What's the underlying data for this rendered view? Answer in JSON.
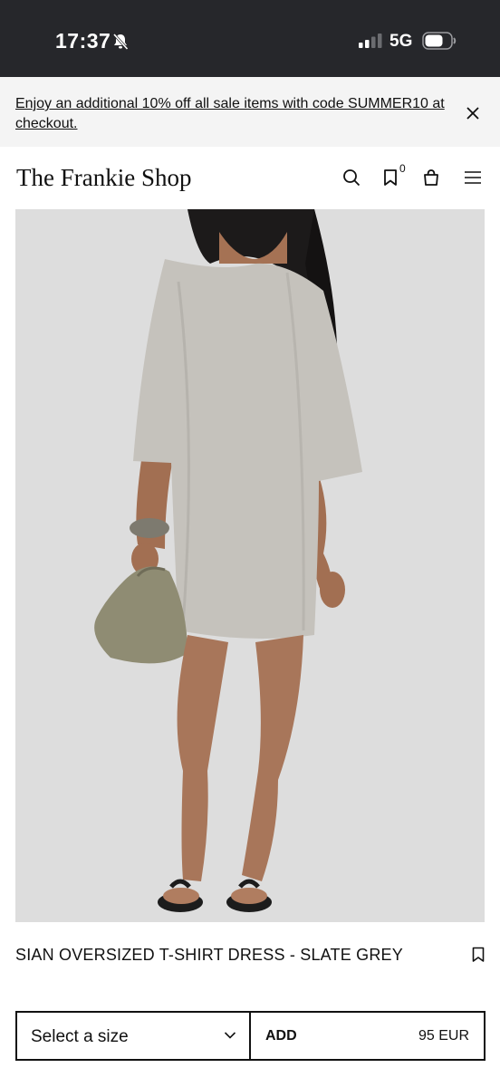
{
  "status_bar": {
    "time": "17:37",
    "network": "5G",
    "bell_icon": "bell-slash-icon",
    "signal_icon": "signal-bars-icon",
    "battery_icon": "battery-icon"
  },
  "promo_banner": {
    "text": "Enjoy an additional 10% off all sale items with code SUMMER10 at checkout.",
    "close_icon": "close-icon"
  },
  "header": {
    "logo": "The Frankie Shop",
    "wishlist_count": "0",
    "icons": [
      "search-icon",
      "bookmark-icon",
      "bag-icon",
      "menu-icon"
    ]
  },
  "product": {
    "name": "SIAN OVERSIZED T-SHIRT DRESS - SLATE GREY",
    "size_select_label": "Select a size",
    "add_label": "ADD",
    "price": "95 EUR"
  },
  "colors": {
    "status_bar_bg": "#26272b",
    "promo_bg": "#f4f4f4",
    "photo_bg": "#dcdcdc",
    "text": "#111111"
  }
}
